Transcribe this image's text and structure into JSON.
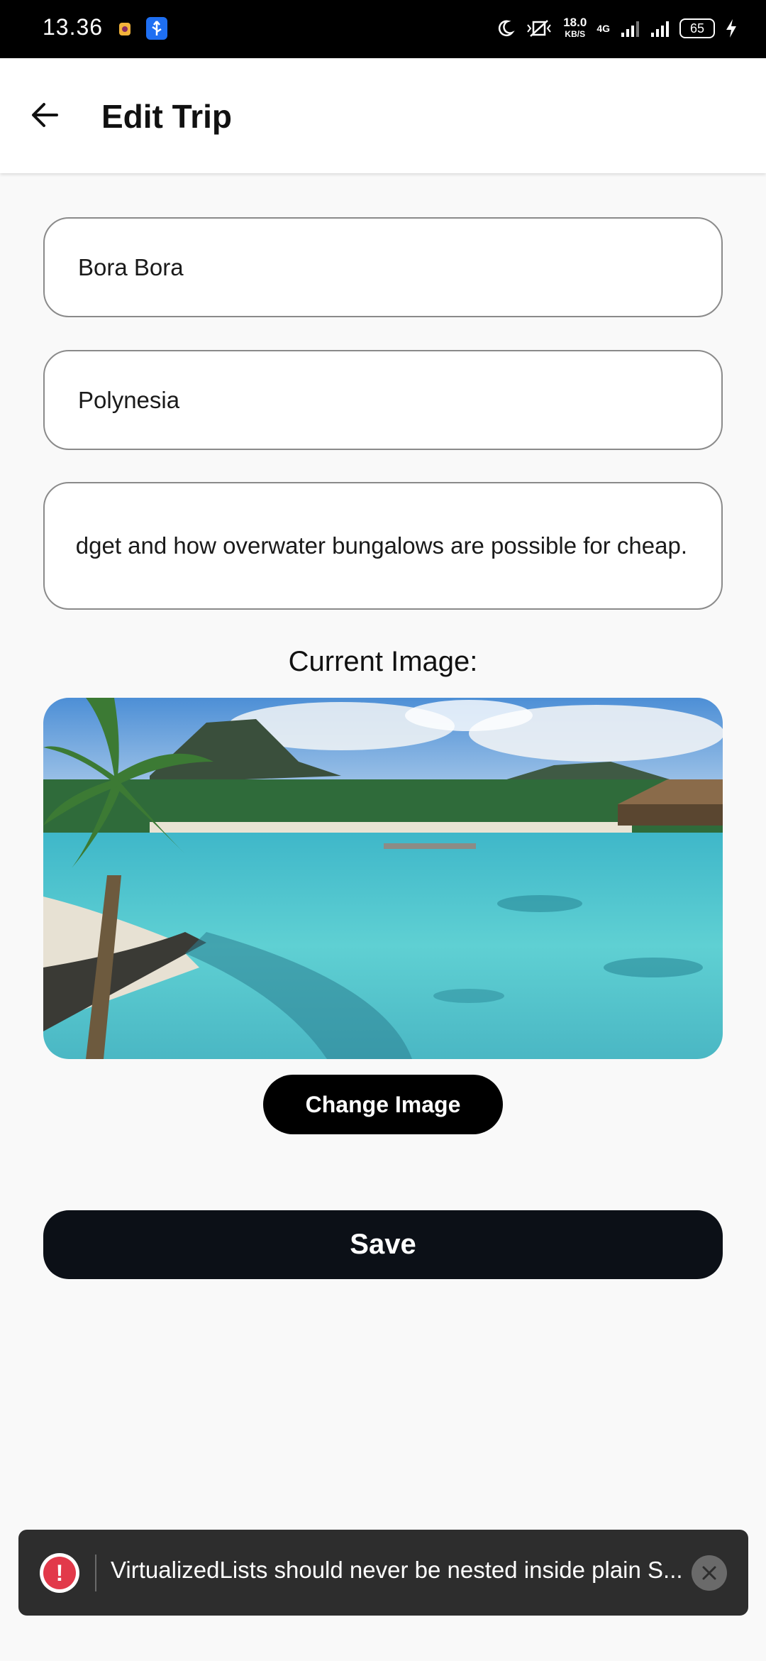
{
  "status_bar": {
    "time": "13.36",
    "net_speed": "18.0",
    "net_unit": "KB/S",
    "network": "4G",
    "battery": "65"
  },
  "header": {
    "title": "Edit Trip"
  },
  "form": {
    "name_value": "Bora Bora",
    "country_value": "Polynesia",
    "description_value": "dget and how overwater bungalows are possible for cheap."
  },
  "image_section": {
    "label": "Current Image:",
    "change_label": "Change Image"
  },
  "save_label": "Save",
  "toast": {
    "message": "VirtualizedLists should never be nested inside plain S...",
    "error_glyph": "!"
  },
  "colors": {
    "primary": "#0c1017",
    "error": "#e2394a",
    "toast_bg": "#2d2d2d"
  }
}
